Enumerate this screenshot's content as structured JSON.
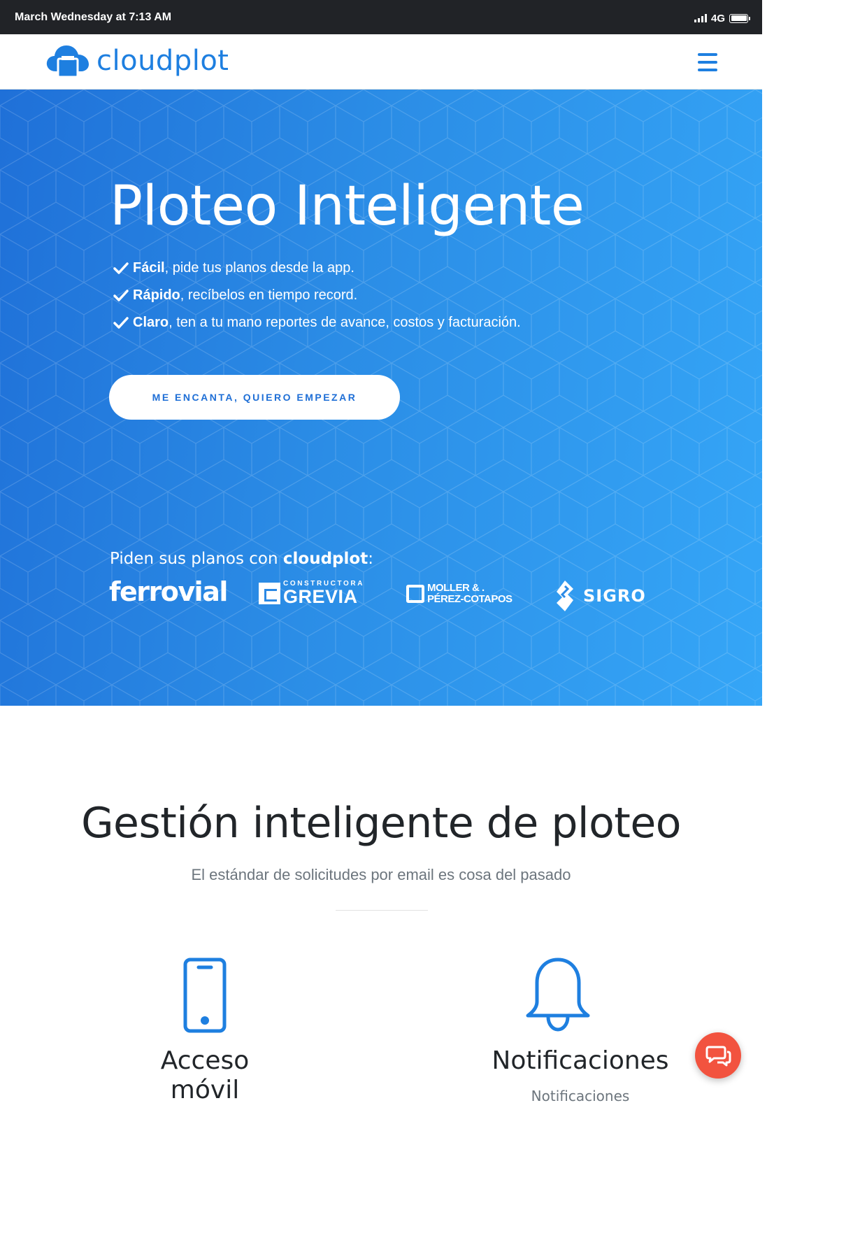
{
  "status_bar": {
    "time": "March Wednesday at 7:13 AM",
    "network": "4G",
    "signal_bars": 4,
    "battery_level": 1.0
  },
  "navbar": {
    "brand_name": "cloudplot",
    "brand_icon": "cloud-printer-icon",
    "menu_icon": "hamburger-menu-icon"
  },
  "hero": {
    "title": "Ploteo Inteligente",
    "features": [
      {
        "bold": "Fácil",
        "text": ", pide tus planos desde la app."
      },
      {
        "bold": "Rápido",
        "text": ", recíbelos en tiempo record."
      },
      {
        "bold": "Claro",
        "text": ", ten a tu mano reportes de avance, costos y facturación."
      }
    ],
    "check_icon": "check-icon",
    "cta_label": "ME ENCANTA, QUIERO EMPEZAR",
    "clients_prefix": "Piden sus planos con ",
    "clients_brand": "cloudplot",
    "clients_suffix": ":",
    "clients": {
      "ferrovial": "ferrovial",
      "grevia_small": "CONSTRUCTORA",
      "grevia": "GREVIA",
      "moller_line1": "MOLLER & .",
      "moller_line2": "PÉREZ-COTAPOS",
      "sigro": "SIGRO"
    }
  },
  "features_section": {
    "title": "Gestión inteligente de ploteo",
    "subtitle": "El estándar de solicitudes por email es cosa del pasado",
    "items": [
      {
        "icon": "mobile-phone-icon",
        "label_line1": "Acceso",
        "label_line2": "móvil"
      },
      {
        "icon": "bell-icon",
        "label_line1": "Notificaciones",
        "label_line2": "Notificaciones"
      }
    ]
  },
  "chat_widget": {
    "icon": "chat-bubbles-icon"
  },
  "colors": {
    "brand_blue": "#1e7fe0",
    "hero_start": "#1f70d8",
    "hero_end": "#35a6f7",
    "chat_orange": "#f2533f",
    "status_bar": "#212327"
  }
}
